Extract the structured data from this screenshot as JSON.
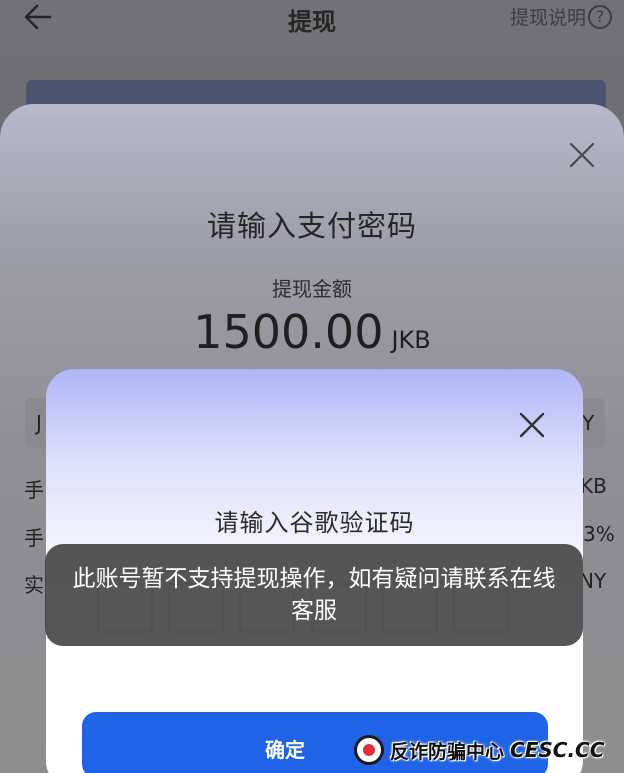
{
  "header": {
    "title": "提现",
    "help_label": "提现说明",
    "help_icon_glyph": "?"
  },
  "pay_dialog": {
    "title": "请输入支付密码",
    "amount_label": "提现金额",
    "amount_value": "1500.00",
    "amount_unit": "JKB",
    "peek_left": [
      "J",
      "手",
      "手",
      "实"
    ],
    "peek_right": [
      "Y",
      "KB",
      "3%",
      "NY"
    ]
  },
  "code_dialog": {
    "title": "请输入谷歌验证码",
    "code_boxes": [
      "",
      "",
      "",
      "",
      "",
      ""
    ],
    "confirm_label": "确定"
  },
  "toast": {
    "message": "此账号暂不支持提现操作，如有疑问请联系在线客服"
  },
  "watermark": {
    "text": "反诈防骗中心",
    "site": "CESC.CC"
  },
  "colors": {
    "primary_button": "#1f63e6",
    "toast_bg": "#3a3a3a",
    "overlay": "#6f6f73"
  }
}
